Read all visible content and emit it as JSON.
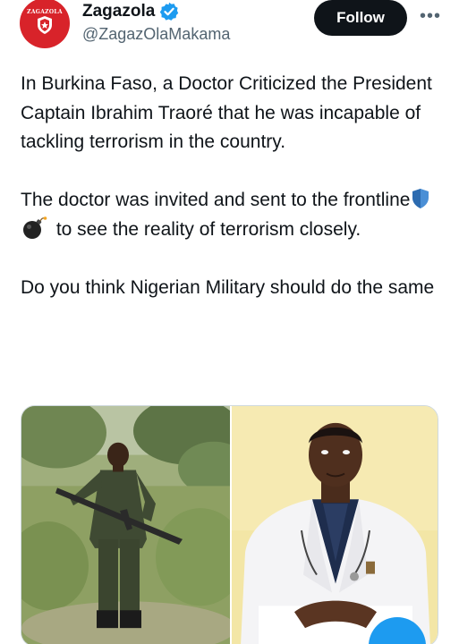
{
  "account": {
    "name": "Zagazola",
    "handle": "@ZagazOlaMakama",
    "avatar_text": "ZAGAZOLA",
    "verified": true
  },
  "actions": {
    "follow_label": "Follow",
    "more_label": "•••"
  },
  "tweet": {
    "paragraph1": "In Burkina Faso, a Doctor Criticized the President Captain Ibrahim Traoré that he was incapable of tackling terrorism in the country.",
    "paragraph2_start": "The doctor was invited and sent to the frontline",
    "paragraph2_end": " to see the reality of terrorism closely.",
    "paragraph3": "Do you think Nigerian Military should do the same",
    "emojis": [
      "shield-emoji",
      "bomb-emoji"
    ]
  },
  "colors": {
    "accent_blue": "#1d9bf0",
    "text_primary": "#0f1419",
    "text_secondary": "#536471",
    "avatar_red": "#d8232a",
    "follow_bg": "#0f1419"
  },
  "media": {
    "photos": [
      "soldier-photo",
      "doctor-photo"
    ]
  }
}
